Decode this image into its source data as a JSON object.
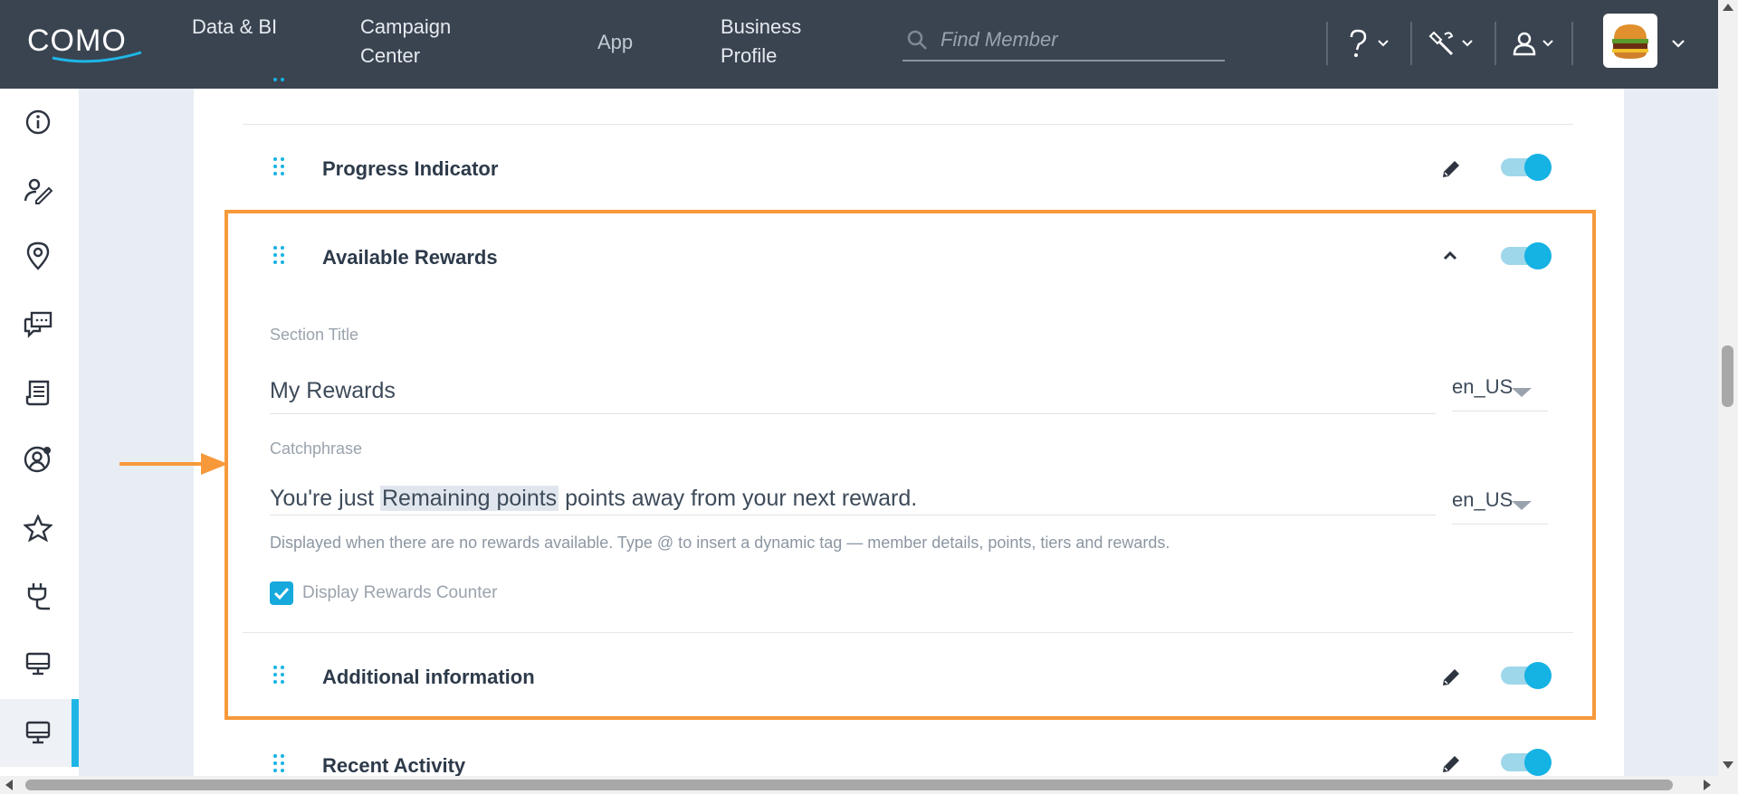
{
  "topbar": {
    "logo_text": "COMO",
    "nav": {
      "data_bi": "Data & BI",
      "campaign_center": "Campaign Center",
      "app": "App",
      "business_profile": "Business Profile"
    },
    "search_placeholder": "Find Member",
    "icons": [
      "help-icon",
      "tools-icon",
      "user-icon",
      "business-avatar"
    ]
  },
  "sidebar": {
    "items": [
      "info-icon",
      "member-edit-icon",
      "location-icon",
      "chat-icon",
      "receipt-icon",
      "user-settings-icon",
      "star-icon",
      "plug-icon",
      "display-icon",
      "display-icon-active"
    ],
    "active_index": 9
  },
  "sections": {
    "progress": {
      "title": "Progress Indicator",
      "enabled": true
    },
    "rewards": {
      "title": "Available Rewards",
      "enabled": true,
      "expanded": true,
      "section_title_label": "Section Title",
      "section_title_value": "My Rewards",
      "section_title_lang": "en_US",
      "catchphrase_label": "Catchphrase",
      "catchphrase_prefix": "You're just",
      "catchphrase_tag": "Remaining points",
      "catchphrase_suffix": "points away from your next reward.",
      "catchphrase_lang": "en_US",
      "helper": "Displayed when there are no rewards available. Type @ to insert a dynamic tag — member details, points, tiers and rewards.",
      "counter_label": "Display Rewards Counter",
      "counter_checked": true
    },
    "additional": {
      "title": "Additional information",
      "enabled": true
    },
    "recent": {
      "title": "Recent Activity",
      "enabled": true
    }
  },
  "colors": {
    "topbar": "#3a4451",
    "accent": "#15b2e4",
    "highlight": "#f7993b"
  }
}
